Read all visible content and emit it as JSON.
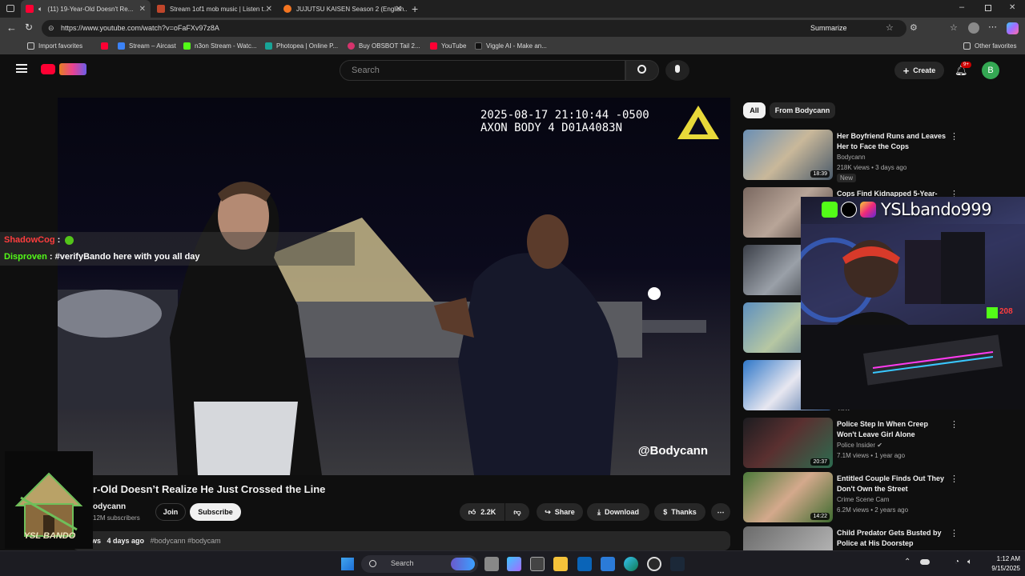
{
  "browser": {
    "tabs": [
      {
        "label": "(11) 19-Year-Old Doesn't Re...",
        "active": true
      },
      {
        "label": "Stream 1of1 mob music | Listen t...",
        "active": false
      },
      {
        "label": "JUJUTSU KAISEN Season 2 (English...",
        "active": false
      }
    ],
    "url": "https://www.youtube.com/watch?v=oFaFXv97z8A",
    "summarize_label": "Summarize",
    "bookmarks": [
      "Import favorites",
      "Stream – Aircast",
      "n3on Stream - Watc...",
      "Photopea | Online P...",
      "Buy OBSBOT Tail 2...",
      "YouTube",
      "Viggle AI - Make an..."
    ],
    "other_favorites": "Other favorites"
  },
  "youtube": {
    "search_placeholder": "Search",
    "create_label": "Create",
    "notif_count": "9+",
    "avatar_letter": "B"
  },
  "video": {
    "timestamp_line1": "2025-08-17 21:10:44 -0500",
    "timestamp_line2": "AXON BODY 4 D01A4083N",
    "watermark": "@Bodycann",
    "chat": [
      {
        "user": "ShadowCog",
        "sep": ":",
        "message": ""
      },
      {
        "user": "Disproven",
        "sep": ":",
        "message": "#verifyBando here with you all day"
      }
    ],
    "title": "r-Old Doesn’t Realize He Just Crossed the Line",
    "channel": "odycann",
    "subscribers": "12M subscribers",
    "join_label": "Join",
    "subscribe_label": "Subscribe",
    "likes": "2.2K",
    "share_label": "Share",
    "download_label": "Download",
    "thanks_label": "Thanks",
    "desc_views": "ws",
    "desc_date": "4 days ago",
    "desc_tags": "#bodycann #bodycam"
  },
  "sidebar": {
    "chips": [
      "All",
      "From Bodycann"
    ],
    "recs": [
      {
        "title": "Her Boyfriend Runs and Leaves Her to Face the Cops",
        "channel": "Bodycann",
        "meta": "218K views • 3 days ago",
        "badge": "New",
        "duration": "18:39"
      },
      {
        "title": "Cops Find Kidnapped 5-Year-",
        "channel": "",
        "meta": "",
        "badge": "",
        "duration": ""
      },
      {
        "title": "Police Step In When Creep Won't Leave Girl Alone",
        "channel": "Police Insider",
        "meta": "7.1M views • 1 year ago",
        "badge": "",
        "duration": "20:37"
      },
      {
        "title": "Entitled Couple Finds Out They Don't Own the Street",
        "channel": "Crime Scene Cam",
        "meta": "6.2M views • 2 years ago",
        "badge": "",
        "duration": "14:22"
      },
      {
        "title": "Child Predator Gets Busted by Police at His Doorstep",
        "channel": "",
        "meta": "",
        "badge": "",
        "duration": ""
      }
    ],
    "partial_label": "vieW"
  },
  "stream": {
    "handle": "YSLbando999",
    "kick_count": "208",
    "logo_text": "YSL BANDO"
  },
  "taskbar": {
    "search_label": "Search",
    "time": "1:12 AM",
    "date": "9/15/2025"
  }
}
